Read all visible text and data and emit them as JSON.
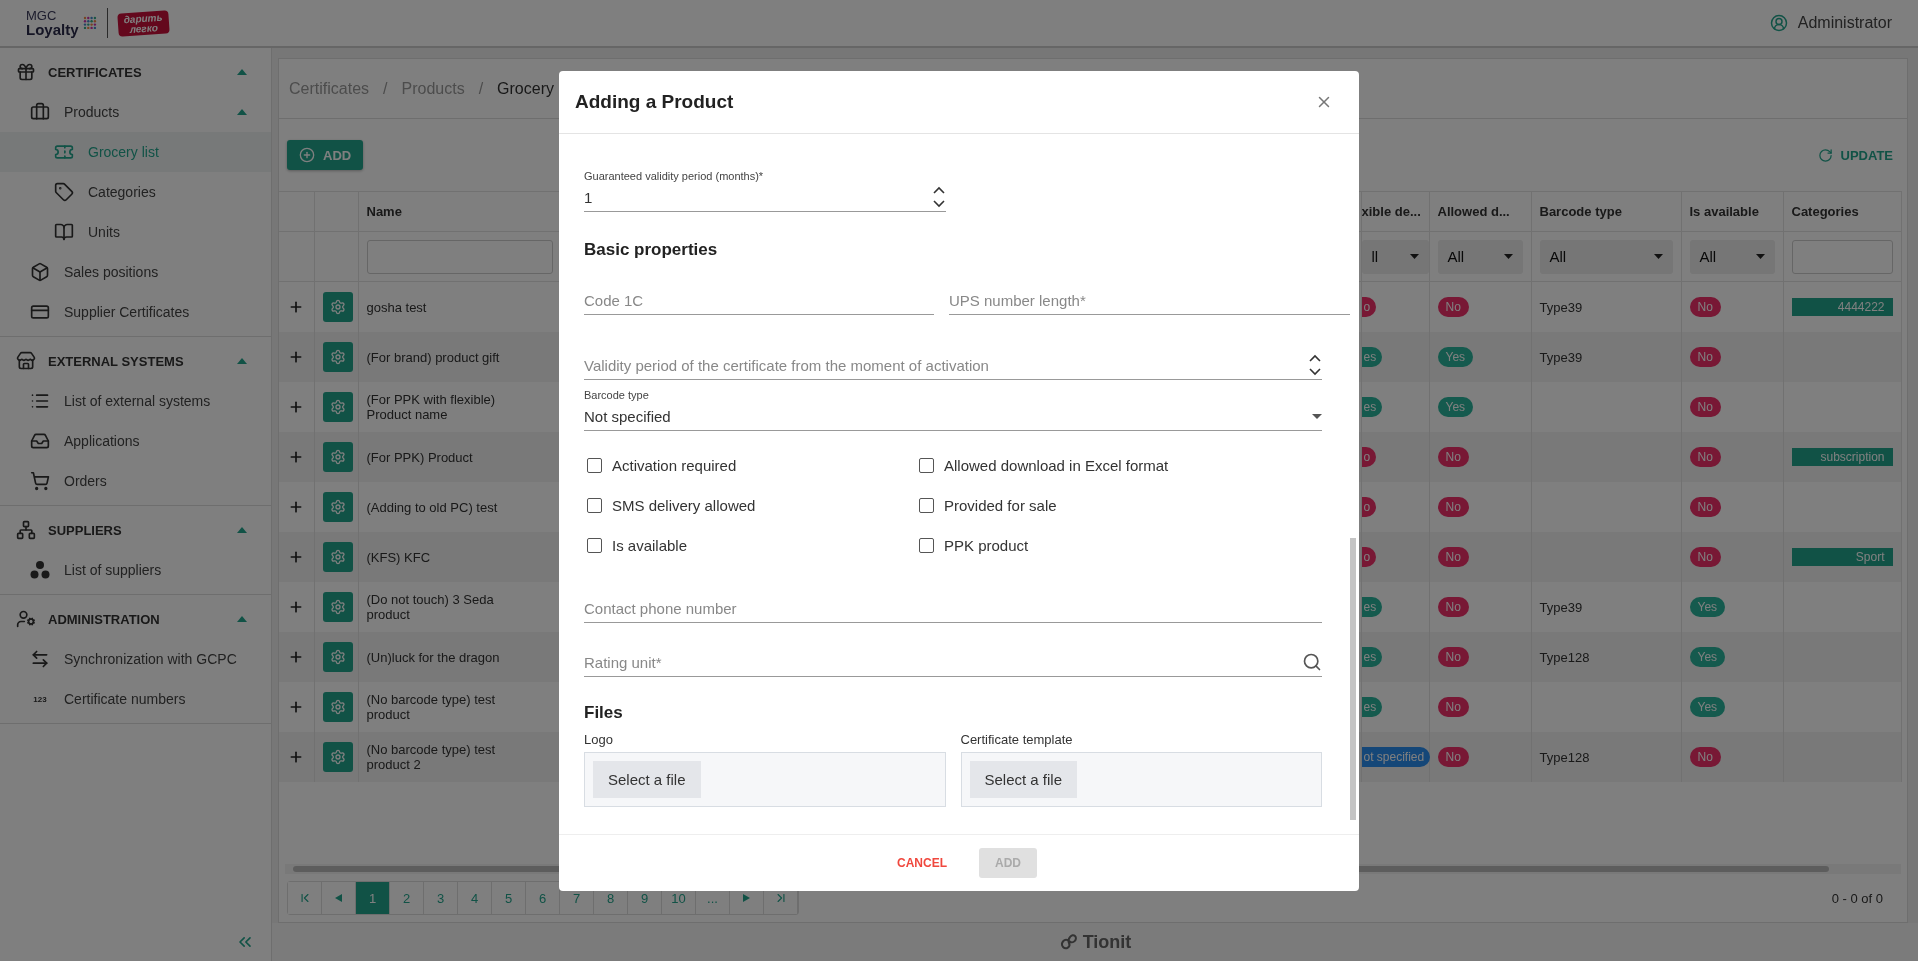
{
  "header": {
    "logo": {
      "line1": "MGC",
      "line2": "Loyalty"
    },
    "partner_logo": {
      "line1": "дарить",
      "line2": "легко"
    },
    "user": "Administrator"
  },
  "sidebar": {
    "sections": [
      {
        "label": "CERTIFICATES",
        "expanded": true,
        "children": [
          {
            "label": "Products",
            "selected": false,
            "expanded": true,
            "children": [
              {
                "label": "Grocery list",
                "selected": true
              },
              {
                "label": "Categories",
                "selected": false
              },
              {
                "label": "Units",
                "selected": false
              }
            ]
          },
          {
            "label": "Sales positions",
            "selected": false
          },
          {
            "label": "Supplier Certificates",
            "selected": false
          }
        ]
      },
      {
        "label": "EXTERNAL SYSTEMS",
        "expanded": true,
        "children": [
          {
            "label": "List of external systems",
            "selected": false
          },
          {
            "label": "Applications",
            "selected": false
          },
          {
            "label": "Orders",
            "selected": false
          }
        ]
      },
      {
        "label": "SUPPLIERS",
        "expanded": true,
        "children": [
          {
            "label": "List of suppliers",
            "selected": false
          }
        ]
      },
      {
        "label": "ADMINISTRATION",
        "expanded": true,
        "children": [
          {
            "label": "Synchronization with GCPC",
            "selected": false
          },
          {
            "label": "Certificate numbers",
            "selected": false,
            "icon_text": "123"
          }
        ]
      }
    ]
  },
  "breadcrumb": [
    {
      "label": "Certificates",
      "separator": "/"
    },
    {
      "label": "Products",
      "separator": "/"
    },
    {
      "label": "Grocery"
    }
  ],
  "toolbar": {
    "add": "ADD",
    "update": "UPDATE"
  },
  "table": {
    "columns": [
      "Name",
      "xible de...",
      "Allowed d...",
      "Barcode type",
      "Is available",
      "Categories"
    ],
    "filters": [
      {
        "kind": "text"
      },
      {
        "kind": "select",
        "value": "ll"
      },
      {
        "kind": "select",
        "value": "All"
      },
      {
        "kind": "select",
        "value": "All"
      },
      {
        "kind": "select",
        "value": "All"
      },
      {
        "kind": "text"
      }
    ],
    "rows": [
      {
        "name": "gosha test",
        "column_2": {
          "text": "o",
          "kind": "no"
        },
        "allowed": {
          "text": "No",
          "kind": "no"
        },
        "barcode": "Type39",
        "available": {
          "text": "No",
          "kind": "no"
        },
        "category": "4444222"
      },
      {
        "name": "(For brand) product gift",
        "column_2": {
          "text": "es",
          "kind": "yes"
        },
        "allowed": {
          "text": "Yes",
          "kind": "yes"
        },
        "barcode": "Type39",
        "available": {
          "text": "No",
          "kind": "no"
        }
      },
      {
        "name": "(For PPK with flexible) Product name",
        "column_2": {
          "text": "es",
          "kind": "yes"
        },
        "allowed": {
          "text": "Yes",
          "kind": "yes"
        },
        "available": {
          "text": "No",
          "kind": "no"
        }
      },
      {
        "name": "(For PPK) Product",
        "column_2": {
          "text": "o",
          "kind": "no"
        },
        "allowed": {
          "text": "No",
          "kind": "no"
        },
        "available": {
          "text": "No",
          "kind": "no"
        },
        "category": "subscription"
      },
      {
        "name": "(Adding to old PC) test",
        "column_2": {
          "text": "o",
          "kind": "no"
        },
        "allowed": {
          "text": "No",
          "kind": "no"
        },
        "available": {
          "text": "No",
          "kind": "no"
        }
      },
      {
        "name": "(KFS) KFC",
        "column_2": {
          "text": "o",
          "kind": "no"
        },
        "allowed": {
          "text": "No",
          "kind": "no"
        },
        "available": {
          "text": "No",
          "kind": "no"
        },
        "category": "Sport"
      },
      {
        "name": "(Do not touch) 3 Seda product",
        "column_2": {
          "text": "es",
          "kind": "yes"
        },
        "allowed": {
          "text": "No",
          "kind": "no"
        },
        "barcode": "Type39",
        "available": {
          "text": "Yes",
          "kind": "yes"
        }
      },
      {
        "name": "(Un)luck for the dragon",
        "column_2": {
          "text": "es",
          "kind": "yes"
        },
        "allowed": {
          "text": "No",
          "kind": "no"
        },
        "barcode": "Type128",
        "available": {
          "text": "Yes",
          "kind": "yes"
        }
      },
      {
        "name": "(No barcode type) test product",
        "column_2": {
          "text": "es",
          "kind": "yes"
        },
        "allowed": {
          "text": "No",
          "kind": "no"
        },
        "available": {
          "text": "Yes",
          "kind": "yes"
        }
      },
      {
        "name": "(No barcode type) test product 2",
        "column_2": {
          "text": "ot specified",
          "kind": "unspecified"
        },
        "allowed": {
          "text": "No",
          "kind": "no"
        },
        "barcode": "Type128",
        "available": {
          "text": "No",
          "kind": "no"
        }
      }
    ]
  },
  "pagination": {
    "pages": [
      {
        "label": "1",
        "selected": true
      },
      {
        "label": "2",
        "selected": false
      },
      {
        "label": "3",
        "selected": false
      },
      {
        "label": "4",
        "selected": false
      },
      {
        "label": "5",
        "selected": false
      },
      {
        "label": "6",
        "selected": false
      },
      {
        "label": "7",
        "selected": false
      },
      {
        "label": "8",
        "selected": false
      },
      {
        "label": "9",
        "selected": false
      },
      {
        "label": "10",
        "selected": false
      },
      {
        "label": "...",
        "selected": false
      }
    ],
    "summary": "0 - 0 of 0"
  },
  "footer": {
    "brand": "Tionit"
  },
  "modal": {
    "title": "Adding a Product",
    "validity_months": {
      "kind": "number",
      "label": "Guaranteed validity period (months)*",
      "value": "1"
    },
    "basic_heading": "Basic properties",
    "code_1c": {
      "kind": "text",
      "placeholder": "Code 1C"
    },
    "ups_number_length": {
      "kind": "number",
      "placeholder": "UPS number length*"
    },
    "validity_period": {
      "kind": "number",
      "placeholder": "Validity period of the certificate from the moment of activation"
    },
    "barcode_type": {
      "label": "Barcode type",
      "value": "Not specified"
    },
    "checkboxes": [
      {
        "label": "Activation required",
        "checked": false
      },
      {
        "label": "Allowed download in Excel format",
        "checked": false
      },
      {
        "label": "SMS delivery allowed",
        "checked": false
      },
      {
        "label": "Provided for sale",
        "checked": false
      },
      {
        "label": "Is available",
        "checked": false
      },
      {
        "label": "PPK product",
        "checked": false
      }
    ],
    "contact_phone": {
      "kind": "text",
      "placeholder": "Contact phone number"
    },
    "rating_unit": {
      "kind": "search",
      "placeholder": "Rating unit*"
    },
    "files_heading": "Files",
    "uploads": [
      {
        "label": "Logo",
        "button": "Select a file"
      },
      {
        "label": "Certificate template",
        "button": "Select a file"
      }
    ],
    "buttons": [
      {
        "label": "CANCEL",
        "kind": "cancel",
        "disabled": false
      },
      {
        "label": "ADD",
        "kind": "primary",
        "disabled": true
      }
    ]
  }
}
